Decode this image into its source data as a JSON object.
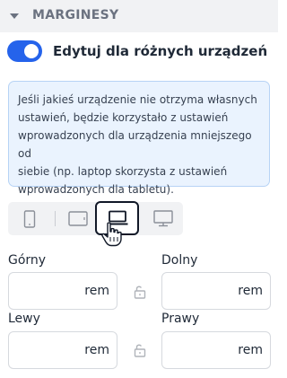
{
  "section": {
    "title": "MARGINESY"
  },
  "toggle": {
    "label": "Edytuj dla różnych urządzeń",
    "on": true
  },
  "info": {
    "lines": [
      "Jeśli jakieś urządzenie nie otrzyma własnych",
      "ustawień, będzie korzystało z ustawień",
      "wprowadzonych dla urządzenia mniejszego od",
      "siebie (np. laptop skorzysta z ustawień",
      "wprowadzonych dla tabletu)."
    ]
  },
  "devices": {
    "selected": "laptop",
    "items": [
      "phone-icon",
      "tablet-icon",
      "laptop-icon",
      "desktop-icon"
    ]
  },
  "fields": {
    "top": {
      "label": "Górny",
      "unit": "rem",
      "value": ""
    },
    "bottom": {
      "label": "Dolny",
      "unit": "rem",
      "value": ""
    },
    "left": {
      "label": "Lewy",
      "unit": "rem",
      "value": ""
    },
    "right": {
      "label": "Prawy",
      "unit": "rem",
      "value": ""
    }
  },
  "colors": {
    "accent": "#2563eb",
    "info_bg": "#eaf3fe",
    "info_border": "#b7d3f5"
  }
}
